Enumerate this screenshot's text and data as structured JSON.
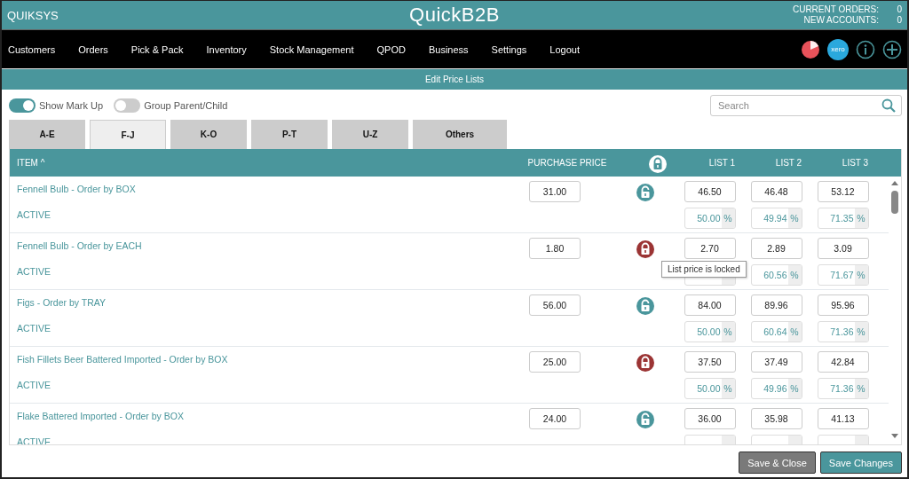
{
  "header": {
    "company": "QUIKSYS",
    "logo": "QuickB2B",
    "counters": [
      {
        "label": "CURRENT ORDERS:",
        "value": "0"
      },
      {
        "label": "NEW ACCOUNTS:",
        "value": "0"
      }
    ]
  },
  "nav": {
    "items": [
      "Customers",
      "Orders",
      "Pick & Pack",
      "Inventory",
      "Stock Management",
      "QPOD",
      "Business",
      "Settings",
      "Logout"
    ],
    "xero_label": "xero"
  },
  "page_title": "Edit Price Lists",
  "toggles": [
    {
      "label": "Show Mark Up",
      "on": true
    },
    {
      "label": "Group Parent/Child",
      "on": false
    }
  ],
  "search": {
    "placeholder": "Search"
  },
  "tabs": [
    {
      "label": "A-E",
      "selected": false
    },
    {
      "label": "F-J",
      "selected": true
    },
    {
      "label": "K-O",
      "selected": false
    },
    {
      "label": "P-T",
      "selected": false
    },
    {
      "label": "U-Z",
      "selected": false
    },
    {
      "label": "Others",
      "selected": false
    }
  ],
  "table": {
    "columns": [
      "ITEM ^",
      "PURCHASE PRICE",
      "LIST 1",
      "LIST 2",
      "LIST 3"
    ],
    "rows": [
      {
        "item": "Fennell Bulb - Order by BOX",
        "status": "ACTIVE",
        "purchase": "31.00",
        "locked": false,
        "lists": [
          {
            "price": "46.50",
            "markup": "50.00",
            "unit": "%"
          },
          {
            "price": "46.48",
            "markup": "49.94",
            "unit": "%"
          },
          {
            "price": "53.12",
            "markup": "71.35",
            "unit": "%"
          }
        ]
      },
      {
        "item": "Fennell Bulb - Order by EACH",
        "status": "ACTIVE",
        "purchase": "1.80",
        "locked": true,
        "tooltip": "List price is locked",
        "lists": [
          {
            "price": "2.70"
          },
          {
            "price": "2.89",
            "markup": "60.56",
            "unit": "%"
          },
          {
            "price": "3.09",
            "markup": "71.67",
            "unit": "%"
          }
        ]
      },
      {
        "item": "Figs - Order by TRAY",
        "status": "ACTIVE",
        "purchase": "56.00",
        "locked": false,
        "lists": [
          {
            "price": "84.00",
            "markup": "50.00",
            "unit": "%"
          },
          {
            "price": "89.96",
            "markup": "60.64",
            "unit": "%"
          },
          {
            "price": "95.96",
            "markup": "71.36",
            "unit": "%"
          }
        ]
      },
      {
        "item": "Fish Fillets Beer Battered Imported - Order by BOX",
        "status": "ACTIVE",
        "purchase": "25.00",
        "locked": true,
        "lists": [
          {
            "price": "37.50",
            "markup": "50.00",
            "unit": "%"
          },
          {
            "price": "37.49",
            "markup": "49.96",
            "unit": "%"
          },
          {
            "price": "42.84",
            "markup": "71.36",
            "unit": "%"
          }
        ]
      },
      {
        "item": "Flake Battered Imported - Order by BOX",
        "status": "ACTIVE",
        "purchase": "24.00",
        "locked": false,
        "lists": [
          {
            "price": "36.00"
          },
          {
            "price": "35.98"
          },
          {
            "price": "41.13"
          }
        ]
      }
    ]
  },
  "buttons": [
    {
      "label": "Save & Close",
      "kind": "secondary"
    },
    {
      "label": "Save Changes",
      "kind": "primary"
    }
  ]
}
